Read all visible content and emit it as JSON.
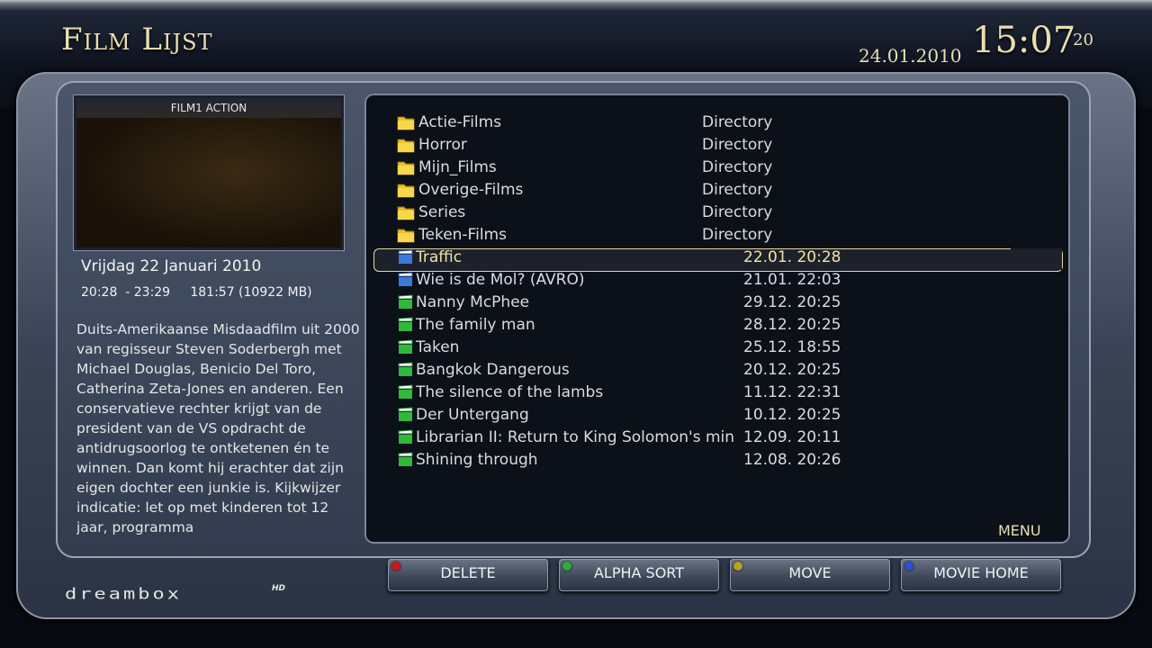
{
  "header": {
    "title": "Film Lijst",
    "date": "24.01.2010",
    "time": "15:07",
    "seconds": "20"
  },
  "preview": {
    "channel": "FILM1 ACTION"
  },
  "epg": {
    "date": "Vrijdag 22 Januari 2010",
    "time_info": "20:28  - 23:29     181:57 (10922 MB)",
    "description": "Duits-Amerikaanse Misdaadfilm uit 2000 van regisseur Steven Soderbergh met Michael Douglas, Benicio Del Toro, Catherina Zeta-Jones en anderen. Een conservatieve rechter krijgt van de president van de VS opdracht de antidrugsoorlog te ontketenen én te winnen. Dan komt hij erachter dat zijn eigen dochter een junkie is. Kijkwijzer indicatie: let op met kinderen tot 12 jaar, programma"
  },
  "list": {
    "rows": [
      {
        "name": "Actie-Films",
        "info": "Directory"
      },
      {
        "name": "Horror",
        "info": "Directory"
      },
      {
        "name": "Mijn_Films",
        "info": "Directory"
      },
      {
        "name": "Overige-Films",
        "info": "Directory"
      },
      {
        "name": "Series",
        "info": "Directory"
      },
      {
        "name": "Teken-Films",
        "info": "Directory"
      },
      {
        "name": "Traffic",
        "info": "22.01. 20:28"
      },
      {
        "name": "Wie is de Mol? (AVRO)",
        "info": "21.01. 22:03"
      },
      {
        "name": "Nanny McPhee",
        "info": "29.12. 20:25"
      },
      {
        "name": "The family man",
        "info": "28.12. 20:25"
      },
      {
        "name": "Taken",
        "info": "25.12. 18:55"
      },
      {
        "name": "Bangkok Dangerous",
        "info": "20.12. 20:25"
      },
      {
        "name": "The silence of the lambs",
        "info": "11.12. 22:31"
      },
      {
        "name": "Der Untergang",
        "info": "10.12. 20:25"
      },
      {
        "name": "Librarian II: Return to King Solomon's min",
        "info": "12.09. 20:11"
      },
      {
        "name": "Shining through",
        "info": "12.08. 20:26"
      }
    ],
    "menu_label": "MENU"
  },
  "buttons": {
    "delete": "DELETE",
    "alpha_sort": "ALPHA SORT",
    "move": "MOVE",
    "movie_home": "MOVIE HOME"
  },
  "colors": {
    "red": "#c81a1a",
    "green": "#2fae2f",
    "yellow": "#b8a21c",
    "blue": "#2a4fd0",
    "accent_gold": "#eadfb0"
  },
  "icons": {
    "folder": "folder-icon",
    "movie": "movie-clapper-icon"
  },
  "branding": {
    "logo": "dreambox",
    "logo_suffix": "HD"
  }
}
